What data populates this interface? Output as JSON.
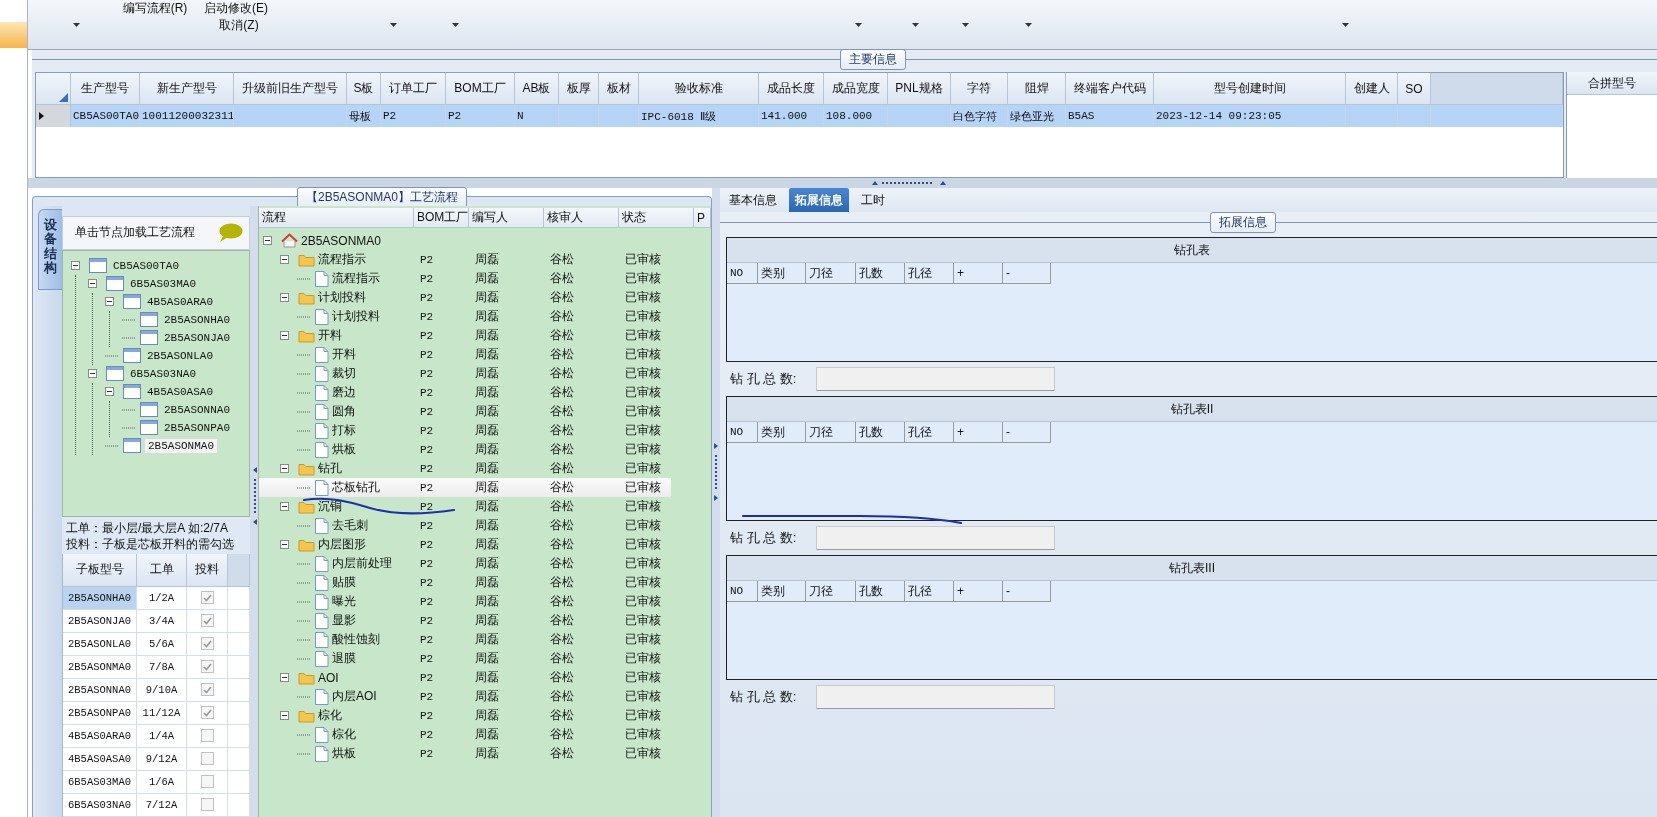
{
  "toolbar": {
    "buttons": [
      {
        "label": "编写流程(R)"
      },
      {
        "label": "启动修改(E)"
      },
      {
        "label": "取消(Z)"
      }
    ]
  },
  "main_info": {
    "title": "主要信息",
    "columns": [
      "生产型号",
      "新生产型号",
      "升级前旧生产型号",
      "S板",
      "订单工厂",
      "BOM工厂",
      "AB板",
      "板厚",
      "板材",
      "验收标准",
      "成品长度",
      "成品宽度",
      "PNL规格",
      "字符",
      "阻焊",
      "终端客户代码",
      "型号创建时间",
      "创建人",
      "SO"
    ],
    "rows": [
      {
        "selected": true,
        "cells": [
          "CB5AS00TA0",
          "10011200032311",
          null,
          "母板",
          "P2",
          "P2",
          "N",
          null,
          null,
          "IPC-6018 Ⅱ级",
          "141.000",
          "108.000",
          null,
          "白色字符",
          "绿色亚光",
          "B5AS",
          "2023-12-14 09:23:05",
          null,
          null
        ]
      }
    ],
    "side_column": "合拼型号"
  },
  "process_panel": {
    "title": "【2B5ASONMA0】工艺流程",
    "side_tab": "设备结构",
    "structure_header": "单击节点加载工艺流程",
    "structure_tree": [
      {
        "label": "CB5AS00TA0",
        "selected": false,
        "expanded": true,
        "children": [
          {
            "label": "6B5AS03MA0",
            "selected": false,
            "expanded": true,
            "children": [
              {
                "label": "4B5AS0ARA0",
                "selected": false,
                "expanded": true,
                "children": [
                  {
                    "label": "2B5ASONHA0",
                    "selected": false
                  },
                  {
                    "label": "2B5ASONJA0",
                    "selected": false
                  }
                ]
              },
              {
                "label": "2B5ASONLA0",
                "selected": false
              }
            ]
          },
          {
            "label": "6B5AS03NA0",
            "selected": false,
            "expanded": true,
            "children": [
              {
                "label": "4B5AS0ASA0",
                "selected": false,
                "expanded": true,
                "children": [
                  {
                    "label": "2B5ASONNA0",
                    "selected": false
                  },
                  {
                    "label": "2B5ASONPA0",
                    "selected": false
                  }
                ]
              },
              {
                "label": "2B5ASONMA0",
                "selected": true
              }
            ]
          }
        ]
      }
    ],
    "note_lines": [
      "工单：最小层/最大层A 如:2/7A",
      "投料：子板是芯板开料的需勾选"
    ],
    "sub_boards": {
      "columns": [
        "子板型号",
        "工单",
        "投料"
      ],
      "rows": [
        {
          "cells": [
            "2B5ASONHA0",
            "1/2A"
          ],
          "checked": true,
          "selected": true
        },
        {
          "cells": [
            "2B5ASONJA0",
            "3/4A"
          ],
          "checked": true,
          "selected": false
        },
        {
          "cells": [
            "2B5ASONLA0",
            "5/6A"
          ],
          "checked": true,
          "selected": false
        },
        {
          "cells": [
            "2B5ASONMA0",
            "7/8A"
          ],
          "checked": true,
          "selected": false
        },
        {
          "cells": [
            "2B5ASONNA0",
            "9/10A"
          ],
          "checked": true,
          "selected": false
        },
        {
          "cells": [
            "2B5ASONPA0",
            "11/12A"
          ],
          "checked": true,
          "selected": false
        },
        {
          "cells": [
            "4B5AS0ARA0",
            "1/4A"
          ],
          "checked": false,
          "selected": false
        },
        {
          "cells": [
            "4B5AS0ASA0",
            "9/12A"
          ],
          "checked": false,
          "selected": false
        },
        {
          "cells": [
            "6B5AS03MA0",
            "1/6A"
          ],
          "checked": false,
          "selected": false
        },
        {
          "cells": [
            "6B5AS03NA0",
            "7/12A"
          ],
          "checked": false,
          "selected": false
        }
      ]
    },
    "flow": {
      "columns": [
        "流程",
        "BOM工厂",
        "编写人",
        "核审人",
        "状态",
        "P"
      ],
      "nodes": [
        {
          "label": "2B5ASONMA0",
          "kind": "root",
          "selected": false,
          "expanded": true,
          "children": [
            {
              "label": "流程指示",
              "kind": "group",
              "bom": "P2",
              "writer": "周磊",
              "reviewer": "谷松",
              "status": "已审核",
              "selected": false,
              "expanded": true,
              "children": [
                {
                  "label": "流程指示",
                  "kind": "step",
                  "bom": "P2",
                  "writer": "周磊",
                  "reviewer": "谷松",
                  "status": "已审核",
                  "selected": false
                }
              ]
            },
            {
              "label": "计划投料",
              "kind": "group",
              "bom": "P2",
              "writer": "周磊",
              "reviewer": "谷松",
              "status": "已审核",
              "selected": false,
              "expanded": true,
              "children": [
                {
                  "label": "计划投料",
                  "kind": "step",
                  "bom": "P2",
                  "writer": "周磊",
                  "reviewer": "谷松",
                  "status": "已审核",
                  "selected": false
                }
              ]
            },
            {
              "label": "开料",
              "kind": "group",
              "bom": "P2",
              "writer": "周磊",
              "reviewer": "谷松",
              "status": "已审核",
              "selected": false,
              "expanded": true,
              "children": [
                {
                  "label": "开料",
                  "kind": "step",
                  "bom": "P2",
                  "writer": "周磊",
                  "reviewer": "谷松",
                  "status": "已审核",
                  "selected": false
                },
                {
                  "label": "裁切",
                  "kind": "step",
                  "bom": "P2",
                  "writer": "周磊",
                  "reviewer": "谷松",
                  "status": "已审核",
                  "selected": false
                },
                {
                  "label": "磨边",
                  "kind": "step",
                  "bom": "P2",
                  "writer": "周磊",
                  "reviewer": "谷松",
                  "status": "已审核",
                  "selected": false
                },
                {
                  "label": "圆角",
                  "kind": "step",
                  "bom": "P2",
                  "writer": "周磊",
                  "reviewer": "谷松",
                  "status": "已审核",
                  "selected": false
                },
                {
                  "label": "打标",
                  "kind": "step",
                  "bom": "P2",
                  "writer": "周磊",
                  "reviewer": "谷松",
                  "status": "已审核",
                  "selected": false
                },
                {
                  "label": "烘板",
                  "kind": "step",
                  "bom": "P2",
                  "writer": "周磊",
                  "reviewer": "谷松",
                  "status": "已审核",
                  "selected": false
                }
              ]
            },
            {
              "label": "钻孔",
              "kind": "group",
              "bom": "P2",
              "writer": "周磊",
              "reviewer": "谷松",
              "status": "已审核",
              "selected": false,
              "expanded": true,
              "children": [
                {
                  "label": "芯板钻孔",
                  "kind": "step",
                  "bom": "P2",
                  "writer": "周磊",
                  "reviewer": "谷松",
                  "status": "已审核",
                  "selected": true
                }
              ]
            },
            {
              "label": "沉铜",
              "kind": "group",
              "bom": "P2",
              "writer": "周磊",
              "reviewer": "谷松",
              "status": "已审核",
              "selected": false,
              "expanded": true,
              "children": [
                {
                  "label": "去毛刺",
                  "kind": "step",
                  "bom": "P2",
                  "writer": "周磊",
                  "reviewer": "谷松",
                  "status": "已审核",
                  "selected": false
                }
              ]
            },
            {
              "label": "内层图形",
              "kind": "group",
              "bom": "P2",
              "writer": "周磊",
              "reviewer": "谷松",
              "status": "已审核",
              "selected": false,
              "expanded": true,
              "children": [
                {
                  "label": "内层前处理",
                  "kind": "step",
                  "bom": "P2",
                  "writer": "周磊",
                  "reviewer": "谷松",
                  "status": "已审核",
                  "selected": false
                },
                {
                  "label": "贴膜",
                  "kind": "step",
                  "bom": "P2",
                  "writer": "周磊",
                  "reviewer": "谷松",
                  "status": "已审核",
                  "selected": false
                },
                {
                  "label": "曝光",
                  "kind": "step",
                  "bom": "P2",
                  "writer": "周磊",
                  "reviewer": "谷松",
                  "status": "已审核",
                  "selected": false
                },
                {
                  "label": "显影",
                  "kind": "step",
                  "bom": "P2",
                  "writer": "周磊",
                  "reviewer": "谷松",
                  "status": "已审核",
                  "selected": false
                },
                {
                  "label": "酸性蚀刻",
                  "kind": "step",
                  "bom": "P2",
                  "writer": "周磊",
                  "reviewer": "谷松",
                  "status": "已审核",
                  "selected": false
                },
                {
                  "label": "退膜",
                  "kind": "step",
                  "bom": "P2",
                  "writer": "周磊",
                  "reviewer": "谷松",
                  "status": "已审核",
                  "selected": false
                }
              ]
            },
            {
              "label": "AOI",
              "kind": "group",
              "bom": "P2",
              "writer": "周磊",
              "reviewer": "谷松",
              "status": "已审核",
              "selected": false,
              "expanded": true,
              "children": [
                {
                  "label": "内层AOI",
                  "kind": "step",
                  "bom": "P2",
                  "writer": "周磊",
                  "reviewer": "谷松",
                  "status": "已审核",
                  "selected": false
                }
              ]
            },
            {
              "label": "棕化",
              "kind": "group",
              "bom": "P2",
              "writer": "周磊",
              "reviewer": "谷松",
              "status": "已审核",
              "selected": false,
              "expanded": true,
              "children": [
                {
                  "label": "棕化",
                  "kind": "step",
                  "bom": "P2",
                  "writer": "周磊",
                  "reviewer": "谷松",
                  "status": "已审核",
                  "selected": false
                },
                {
                  "label": "烘板",
                  "kind": "step",
                  "bom": "P2",
                  "writer": "周磊",
                  "reviewer": "谷松",
                  "status": "已审核",
                  "selected": false
                }
              ]
            }
          ]
        }
      ]
    }
  },
  "right_panel": {
    "tabs": [
      {
        "label": "基本信息",
        "selected": false
      },
      {
        "label": "拓展信息",
        "selected": true
      },
      {
        "label": "工时",
        "selected": false
      }
    ],
    "group_title": "拓展信息",
    "tables": [
      {
        "title": "钻孔表",
        "columns": [
          "NO",
          "类别",
          "刀径",
          "孔数",
          "孔径",
          "+",
          "-"
        ],
        "total_label": "钻 孔 总 数:"
      },
      {
        "title": "钻孔表II",
        "columns": [
          "NO",
          "类别",
          "刀径",
          "孔数",
          "孔径",
          "+",
          "-"
        ],
        "total_label": "钻 孔 总 数:"
      },
      {
        "title": "钻孔表III",
        "columns": [
          "NO",
          "类别",
          "刀径",
          "孔数",
          "孔径",
          "+",
          "-"
        ],
        "total_label": "钻 孔 总 数:"
      }
    ]
  }
}
